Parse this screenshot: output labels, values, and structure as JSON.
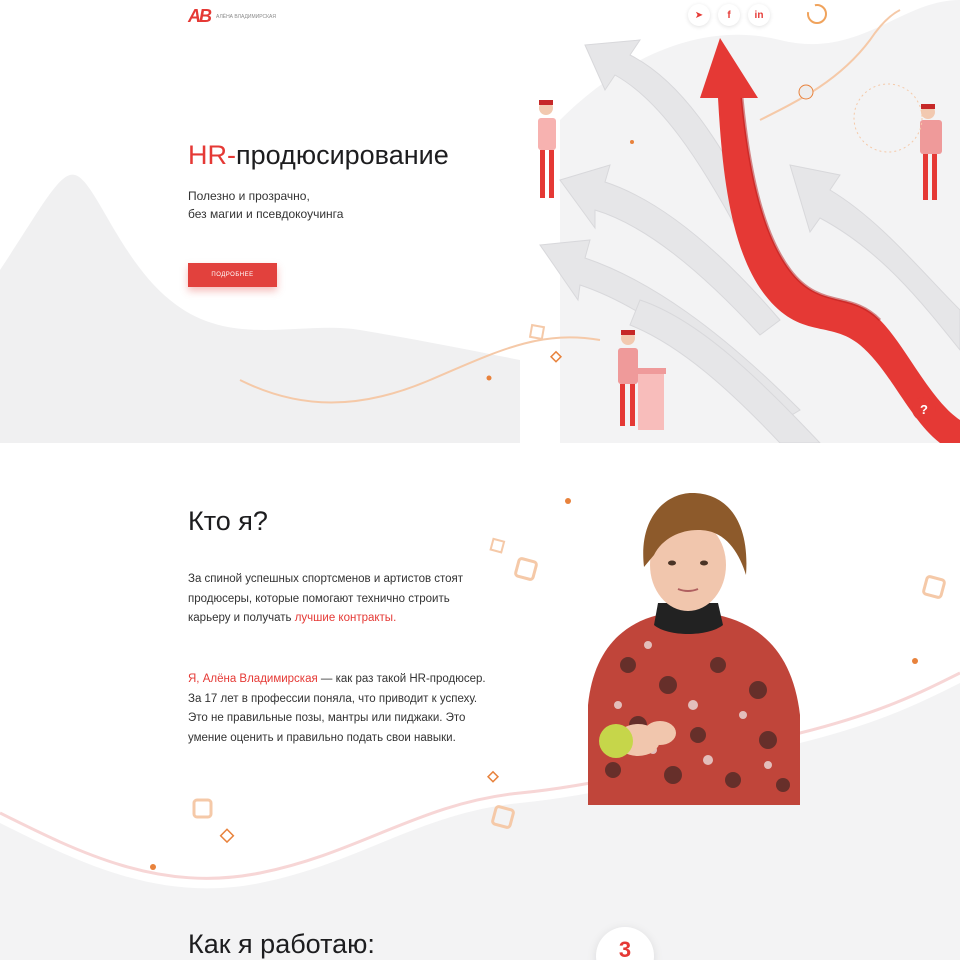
{
  "header": {
    "logo_mark": "AB",
    "logo_name": "Алёна Владимирская",
    "socials": [
      {
        "icon": "telegram-icon",
        "label": "➤"
      },
      {
        "icon": "facebook-icon",
        "label": "f"
      },
      {
        "icon": "linkedin-icon",
        "label": "in"
      }
    ]
  },
  "hero": {
    "title_accent": "HR-",
    "title_rest": "продюсирование",
    "subtitle_line1": "Полезно и прозрачно,",
    "subtitle_line2": "без магии и псевдокоучинга",
    "button_label": "подробнее",
    "help_label": "?"
  },
  "about": {
    "title": "Кто я?",
    "p1_text": "За спиной успешных спортсменов и артистов стоят продюсеры, которые помогают технично строить карьеру и получать ",
    "p1_highlight": "лучшие контракты.",
    "p2_highlight": "Я, Алёна Владимирская",
    "p2_text": " — как раз такой HR-продюсер. За 17 лет в профессии поняла, что приводит к успеху. Это не правильные позы, мантры или пиджаки. Это умение оценить и правильно подать свои навыки."
  },
  "process": {
    "title": "Как я работаю:",
    "number": "3"
  },
  "colors": {
    "accent": "#e53935",
    "light_gray": "#eeeeef",
    "peach": "#f5c9a8",
    "orange": "#e8823c"
  }
}
